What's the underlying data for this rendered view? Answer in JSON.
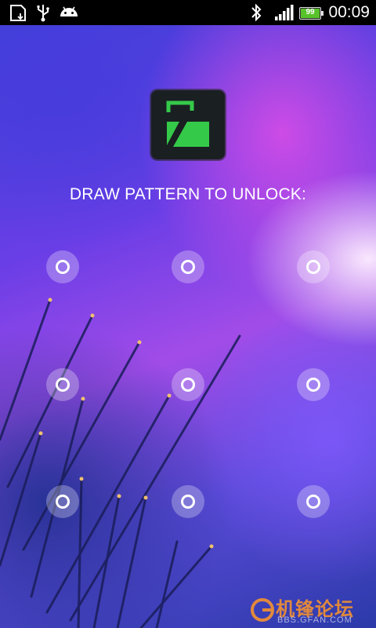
{
  "status_bar": {
    "time": "00:09",
    "battery_level": "99",
    "battery_fraction": 0.99,
    "icons": [
      "sd-card-icon",
      "usb-icon",
      "android-icon",
      "bluetooth-icon",
      "signal-icon",
      "battery-icon"
    ]
  },
  "app": {
    "icon": "lock-app-icon",
    "accent": "#35c94a"
  },
  "prompt": {
    "text": "DRAW PATTERN TO UNLOCK:"
  },
  "pattern_grid": {
    "rows": 3,
    "cols": 3,
    "dots": [
      "1",
      "2",
      "3",
      "4",
      "5",
      "6",
      "7",
      "8",
      "9"
    ]
  },
  "watermark": {
    "cn_text": "机锋论坛",
    "url": "BBS.GFAN.COM"
  }
}
